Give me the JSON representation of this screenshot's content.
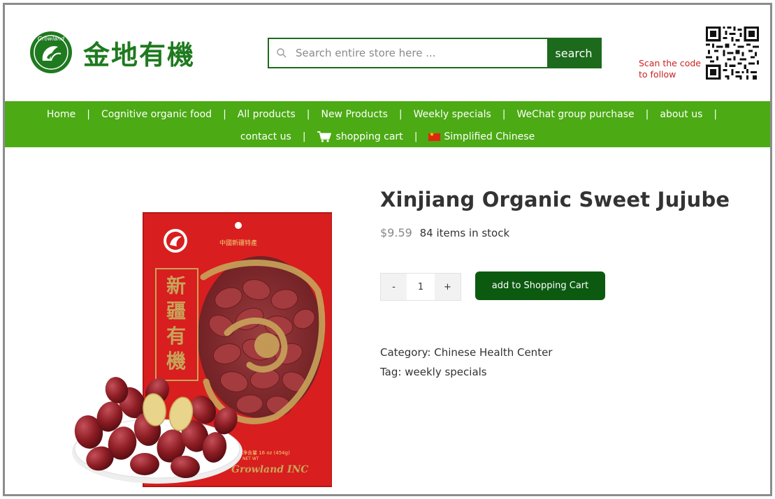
{
  "header": {
    "logo_text": "金地有機",
    "logo_badge_text": "Growland",
    "search": {
      "placeholder": "Search entire store here ...",
      "button_label": "search"
    },
    "scan_text": "Scan the code to follow"
  },
  "nav": {
    "row1": [
      "Home",
      "Cognitive organic food",
      "All products",
      "New Products",
      "Weekly specials",
      "WeChat group purchase",
      "about us"
    ],
    "row2": {
      "contact": "contact us",
      "cart": "shopping cart",
      "language": "Simplified Chinese"
    }
  },
  "product": {
    "title": "Xinjiang Organic Sweet Jujube",
    "price": "$9.59",
    "stock": "84 items in stock",
    "quantity": {
      "minus": "-",
      "value": "1",
      "plus": "+"
    },
    "add_to_cart": "add to Shopping Cart",
    "category_label": "Category:",
    "category_value": "Chinese Health Center",
    "tag_label": "Tag:",
    "tag_value": "weekly specials",
    "package_text": {
      "top": "中國新疆特產",
      "vertical": "新疆有機",
      "brand": "Growland INC",
      "weight": "净含量 16 oz (454g)",
      "net_wt": "NET WT"
    }
  },
  "colors": {
    "brand_green": "#1f7a1f",
    "nav_green": "#4caa14",
    "button_green": "#0c5a10",
    "scan_red": "#cc1f1f",
    "package_red": "#d81e1e"
  }
}
